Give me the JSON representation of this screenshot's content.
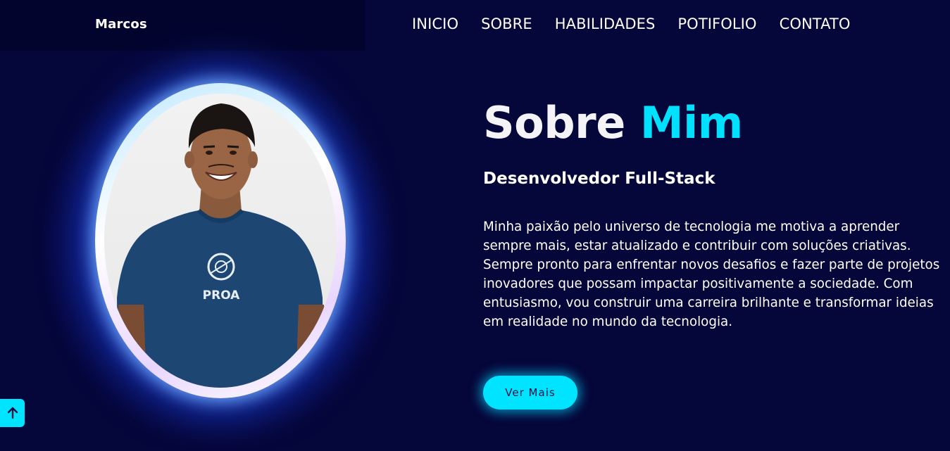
{
  "header": {
    "brand": "Marcos",
    "nav": [
      "INICIO",
      "SOBRE",
      "HABILIDADES",
      "POTIFOLIO",
      "CONTATO"
    ]
  },
  "about": {
    "heading_plain": "Sobre",
    "heading_accent": "Mim",
    "subtitle": "Desenvolvedor Full-Stack",
    "bio": "Minha paixão pelo universo de tecnologia me motiva a aprender sempre mais, estar atualizado e contribuir com soluções criativas. Sempre pronto para enfrentar novos desafios e fazer parte de projetos inovadores que possam impactar positivamente a sociedade. Com entusiasmo, vou construir uma carreira brilhante e transformar ideias em realidade no mundo da tecnologia.",
    "button_label": "Ver Mais",
    "shirt_text": "PROA"
  },
  "icons": {
    "back_to_top": "arrow-up-icon"
  },
  "colors": {
    "background": "#05063a",
    "accent": "#00e1ff",
    "text": "#ffffff"
  }
}
